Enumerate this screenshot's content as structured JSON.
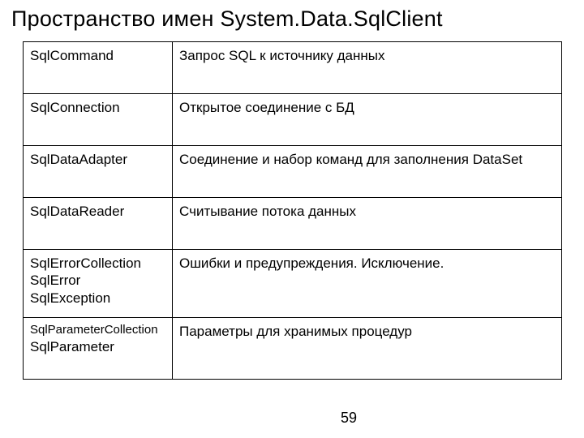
{
  "title": "Пространство имен System.Data.SqlClient",
  "page_number": "59",
  "rows": [
    {
      "names": [
        "SqlCommand"
      ],
      "desc": "Запрос SQL к источнику данных"
    },
    {
      "names": [
        "SqlConnection"
      ],
      "desc": "Открытое соединение с БД"
    },
    {
      "names": [
        "SqlDataAdapter"
      ],
      "desc": "Соединение и набор команд для заполнения DataSet"
    },
    {
      "names": [
        "SqlDataReader"
      ],
      "desc": "Считывание потока данных"
    },
    {
      "names": [
        "SqlErrorCollection",
        "SqlError",
        "SqlException"
      ],
      "desc": "Ошибки и предупреждения. Исключение."
    },
    {
      "names": [
        "SqlParameterCollection",
        "SqlParameter"
      ],
      "desc": "Параметры для хранимых процедур"
    }
  ]
}
